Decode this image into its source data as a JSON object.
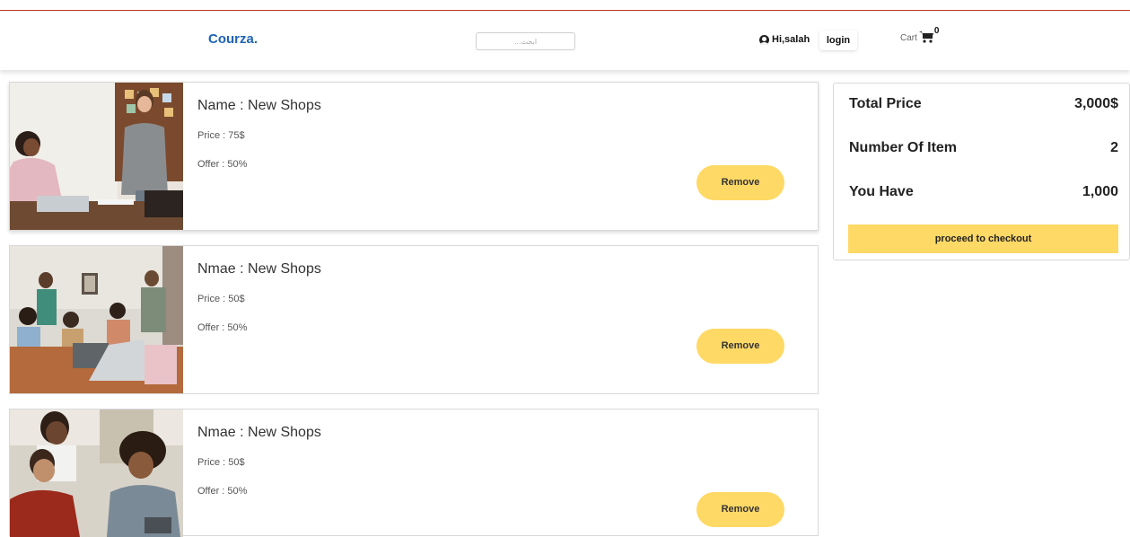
{
  "header": {
    "brand": "Courza.",
    "search_placeholder": "...ابحث",
    "greeting": "Hi,salah",
    "login_label": "login",
    "cart_label": "Cart",
    "cart_count": "0"
  },
  "items": [
    {
      "name": "Name : New Shops",
      "price": "Price : 75$",
      "offer": "Offer : 50%",
      "remove_label": "Remove"
    },
    {
      "name": "Nmae : New Shops",
      "price": "Price : 50$",
      "offer": "Offer : 50%",
      "remove_label": "Remove"
    },
    {
      "name": "Nmae : New Shops",
      "price": "Price : 50$",
      "offer": "Offer : 50%",
      "remove_label": "Remove"
    }
  ],
  "summary": {
    "total_label": "Total Price",
    "total_value": "3,000$",
    "count_label": "Number Of Item",
    "count_value": "2",
    "have_label": "You Have",
    "have_value": "1,000",
    "checkout_label": "proceed to checkout"
  },
  "colors": {
    "brand": "#1e63b6",
    "accent_yellow": "#ffd966",
    "top_border": "#c0392b"
  }
}
